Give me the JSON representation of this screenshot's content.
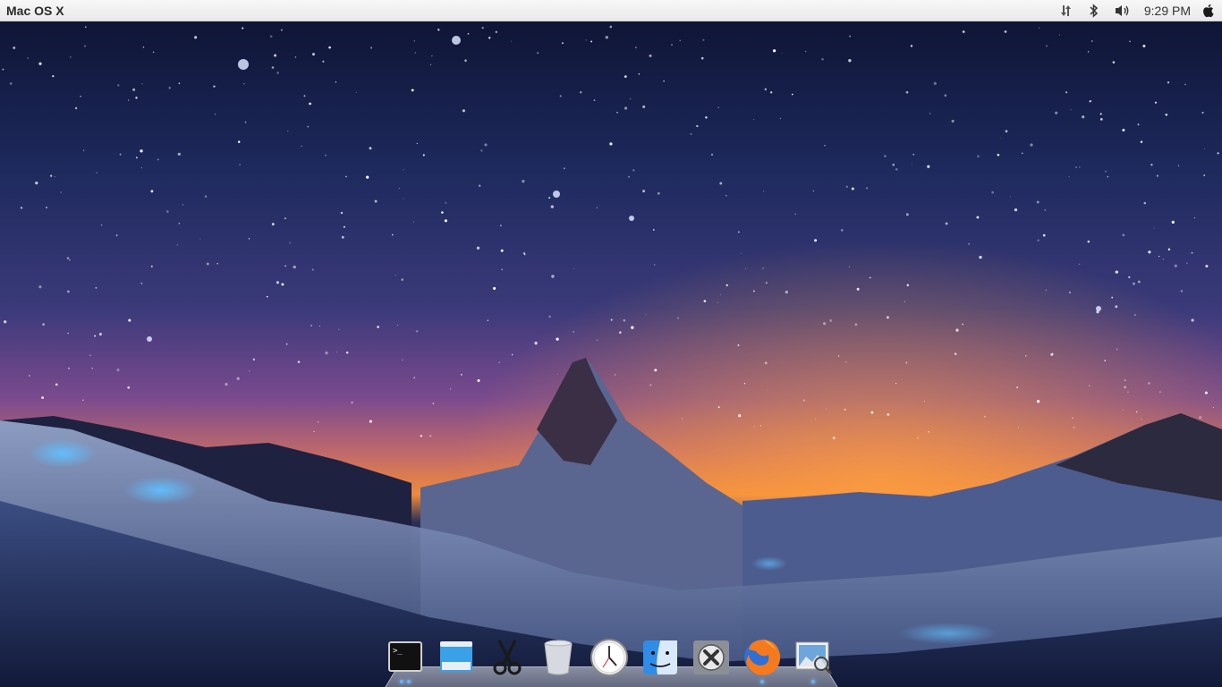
{
  "menubar": {
    "app_title": "Mac OS X",
    "clock": "9:29 PM",
    "tray_icons": [
      "network-icon",
      "bluetooth-icon",
      "volume-icon"
    ],
    "apple_menu_icon": "apple-logo-icon"
  },
  "dock": {
    "items": [
      {
        "icon": "terminal-icon",
        "running": true
      },
      {
        "icon": "window-icon",
        "running": false
      },
      {
        "icon": "scissors-icon",
        "running": false
      },
      {
        "icon": "trash-icon",
        "running": false
      },
      {
        "icon": "clock-icon",
        "running": false
      },
      {
        "icon": "finder-icon",
        "running": false
      },
      {
        "icon": "settings-icon",
        "running": false
      },
      {
        "icon": "firefox-icon",
        "running": true
      },
      {
        "icon": "image-viewer-icon",
        "running": true
      }
    ]
  },
  "colors": {
    "sky_top": "#141a3d",
    "sky_mid": "#5a4a8a",
    "horizon_glow": "#f0903a",
    "snow": "#c8d4ea",
    "rock": "#2a2838",
    "dock_indicator": "#5fb3ff"
  }
}
